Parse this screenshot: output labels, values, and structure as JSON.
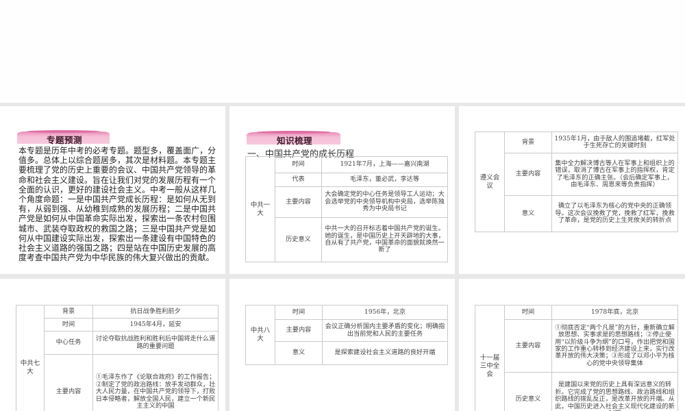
{
  "slides": [
    {
      "banner": "专题预测",
      "intro": "本专题是历年中考的必考专题。题型多，覆盖面广，分值多。总体上以综合题居多，其次是材料题。本专题主要梳理了党的历史上重要的会议、中国共产党领导的革命和社会主义建设。旨在让我们对党的发展历程有一个全面的认识，更好的建设社会主义。中考一般从这样几个角度命题：一是中国共产党成长历程：是如何从无到有，从弱到强、从幼稚到成熟的发展历程；二是中国共产党是如何从中国革命实际出发，探索出一条农村包围城市、武装夺取政权的救国之路；三是中国共产党是如何从中国建设实际出发，探索出一条建设有中国特色的社会主义道路的强国之路；四是站在中国历史发展的高度考查中国共产党为中华民族的伟大复兴做出的贡献。"
    },
    {
      "banner": "知识梳理",
      "subtitle": "一、中国共产党的成长历程",
      "table": {
        "event": "中共一大",
        "rows": [
          {
            "label": "时间",
            "content": "1921年7月，上海——嘉兴南湖"
          },
          {
            "label": "代表",
            "content": "毛泽东，董必武，李达等"
          },
          {
            "label": "主要内容",
            "content": "大会确定党的中心任务是领导工人运动；大会选举党的中央领导机构中央局，选举陈独秀为中央局书记"
          },
          {
            "label": "历史意义",
            "content": "中共一大的召开标志着中国共产党的诞生。她的诞生，是中国历史上开天辟地的大事，自从有了共产党，中国革命的面貌就焕然一新了"
          }
        ]
      }
    },
    {
      "table": {
        "event": "遵义会议",
        "rows": [
          {
            "label": "背景",
            "content": "1935年1月，由于敌人的围追堵截，红军处于生死存亡的关键时刻"
          },
          {
            "label": "主要内容",
            "content": "集中全力解决博古等人在军事上和组织上的错误，取消了博古在军事上的指挥权，肯定了毛泽东的正确主张。（会后确定军事上，由毛泽东、周恩来等负责指挥）"
          },
          {
            "label": "意义",
            "content": "确立了以毛泽东为核心的党中央的正确领导。这次会议挽救了党，挽救了红军，挽救了革命，是党的历史上生死攸关的转折点"
          }
        ]
      }
    },
    {
      "table": {
        "event": "中共七大",
        "rows": [
          {
            "label": "背景",
            "content": "抗日战争胜利前夕"
          },
          {
            "label": "时间",
            "content": "1945年4月，延安"
          },
          {
            "label": "中心任务",
            "content": "讨论夺取抗战胜利和胜利后中国将走什么道路的重要问题"
          },
          {
            "label": "主要内容",
            "content": "①毛泽东作了《论联合政府》的工作报告；②制定了党的政治路线：放手发动群众，壮大人民力量，在中国共产党的领导下，打败日本侵略者，解放全国人民，建立一个新民主主义的中国"
          }
        ]
      }
    },
    {
      "table": {
        "event": "中共八大",
        "rows": [
          {
            "label": "时间",
            "content": "1956年，北京"
          },
          {
            "label": "主要内容",
            "content": "会议正确分析国内主要矛盾的变化；明确指出当前党和人民的主要任务"
          },
          {
            "label": "意义",
            "content": "是探索建设社会主义道路的良好开端"
          }
        ]
      }
    },
    {
      "table": {
        "event": "十一届三中全会",
        "rows": [
          {
            "label": "时间",
            "content": "1978年底，北京"
          },
          {
            "label": "主要内容",
            "content": "①彻底否定“两个凡是”的方针，重新确立解放思想、实事求是的思想路线；②停止使用“以阶级斗争为纲”的口号，作出把党和国家的工作重心转移到经济建设上来，实行改革开放的伟大决策；③形成了以邓小平为核心的党中央领导集体"
          },
          {
            "label": "历史意义",
            "content": "是建国以来党的历史上具有深远意义的转折。它完成了党的思想路线、政治路线和组织路线的拨乱反正，是改革开放的开端。从此，中国历史进入社会主义现代化建设的新时期"
          }
        ]
      }
    }
  ]
}
